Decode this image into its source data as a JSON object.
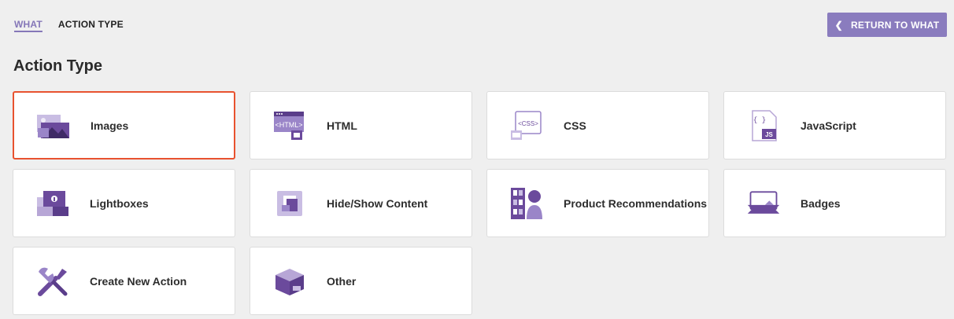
{
  "breadcrumb": {
    "parent": "WHAT",
    "current": "ACTION TYPE"
  },
  "header": {
    "return_button": "RETURN TO WHAT",
    "return_icon": "chevron-left-icon"
  },
  "page": {
    "title": "Action Type"
  },
  "action_types": [
    {
      "label": "Images",
      "icon": "images-icon",
      "selected": true
    },
    {
      "label": "HTML",
      "icon": "html-icon",
      "selected": false
    },
    {
      "label": "CSS",
      "icon": "css-icon",
      "selected": false
    },
    {
      "label": "JavaScript",
      "icon": "javascript-icon",
      "selected": false
    },
    {
      "label": "Lightboxes",
      "icon": "lightboxes-icon",
      "selected": false
    },
    {
      "label": "Hide/Show Content",
      "icon": "hide-show-icon",
      "selected": false
    },
    {
      "label": "Product Recommendations",
      "icon": "product-recommendations-icon",
      "selected": false
    },
    {
      "label": "Badges",
      "icon": "badges-icon",
      "selected": false
    },
    {
      "label": "Create New Action",
      "icon": "tools-icon",
      "selected": false
    },
    {
      "label": "Other",
      "icon": "box-icon",
      "selected": false
    }
  ],
  "colors": {
    "accent": "#8a7cbe",
    "icon_primary": "#6b4a9c",
    "icon_secondary": "#b7a6d6",
    "selected_border": "#e8522f",
    "background": "#efefef"
  },
  "icon_labels": {
    "html": "<HTML>",
    "css": "<CSS>",
    "js": "JS",
    "braces": "{ }"
  }
}
